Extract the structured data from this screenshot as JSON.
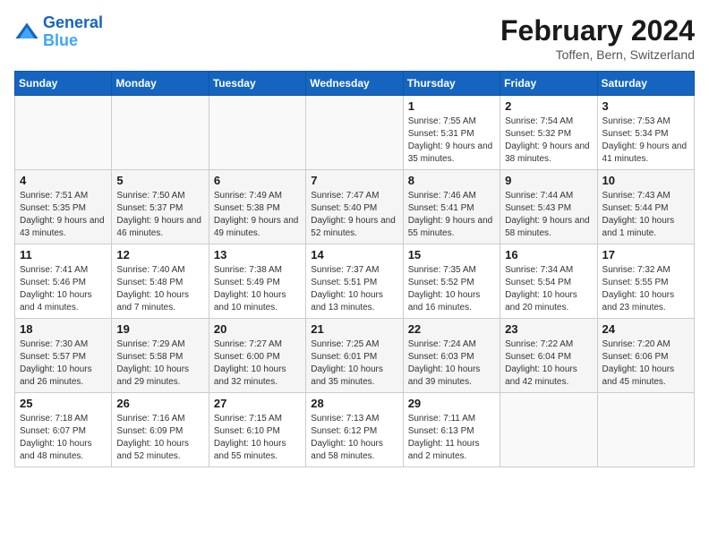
{
  "header": {
    "logo_line1": "General",
    "logo_line2": "Blue",
    "month_title": "February 2024",
    "subtitle": "Toffen, Bern, Switzerland"
  },
  "weekdays": [
    "Sunday",
    "Monday",
    "Tuesday",
    "Wednesday",
    "Thursday",
    "Friday",
    "Saturday"
  ],
  "weeks": [
    [
      {
        "day": "",
        "info": ""
      },
      {
        "day": "",
        "info": ""
      },
      {
        "day": "",
        "info": ""
      },
      {
        "day": "",
        "info": ""
      },
      {
        "day": "1",
        "info": "Sunrise: 7:55 AM\nSunset: 5:31 PM\nDaylight: 9 hours\nand 35 minutes."
      },
      {
        "day": "2",
        "info": "Sunrise: 7:54 AM\nSunset: 5:32 PM\nDaylight: 9 hours\nand 38 minutes."
      },
      {
        "day": "3",
        "info": "Sunrise: 7:53 AM\nSunset: 5:34 PM\nDaylight: 9 hours\nand 41 minutes."
      }
    ],
    [
      {
        "day": "4",
        "info": "Sunrise: 7:51 AM\nSunset: 5:35 PM\nDaylight: 9 hours\nand 43 minutes."
      },
      {
        "day": "5",
        "info": "Sunrise: 7:50 AM\nSunset: 5:37 PM\nDaylight: 9 hours\nand 46 minutes."
      },
      {
        "day": "6",
        "info": "Sunrise: 7:49 AM\nSunset: 5:38 PM\nDaylight: 9 hours\nand 49 minutes."
      },
      {
        "day": "7",
        "info": "Sunrise: 7:47 AM\nSunset: 5:40 PM\nDaylight: 9 hours\nand 52 minutes."
      },
      {
        "day": "8",
        "info": "Sunrise: 7:46 AM\nSunset: 5:41 PM\nDaylight: 9 hours\nand 55 minutes."
      },
      {
        "day": "9",
        "info": "Sunrise: 7:44 AM\nSunset: 5:43 PM\nDaylight: 9 hours\nand 58 minutes."
      },
      {
        "day": "10",
        "info": "Sunrise: 7:43 AM\nSunset: 5:44 PM\nDaylight: 10 hours\nand 1 minute."
      }
    ],
    [
      {
        "day": "11",
        "info": "Sunrise: 7:41 AM\nSunset: 5:46 PM\nDaylight: 10 hours\nand 4 minutes."
      },
      {
        "day": "12",
        "info": "Sunrise: 7:40 AM\nSunset: 5:48 PM\nDaylight: 10 hours\nand 7 minutes."
      },
      {
        "day": "13",
        "info": "Sunrise: 7:38 AM\nSunset: 5:49 PM\nDaylight: 10 hours\nand 10 minutes."
      },
      {
        "day": "14",
        "info": "Sunrise: 7:37 AM\nSunset: 5:51 PM\nDaylight: 10 hours\nand 13 minutes."
      },
      {
        "day": "15",
        "info": "Sunrise: 7:35 AM\nSunset: 5:52 PM\nDaylight: 10 hours\nand 16 minutes."
      },
      {
        "day": "16",
        "info": "Sunrise: 7:34 AM\nSunset: 5:54 PM\nDaylight: 10 hours\nand 20 minutes."
      },
      {
        "day": "17",
        "info": "Sunrise: 7:32 AM\nSunset: 5:55 PM\nDaylight: 10 hours\nand 23 minutes."
      }
    ],
    [
      {
        "day": "18",
        "info": "Sunrise: 7:30 AM\nSunset: 5:57 PM\nDaylight: 10 hours\nand 26 minutes."
      },
      {
        "day": "19",
        "info": "Sunrise: 7:29 AM\nSunset: 5:58 PM\nDaylight: 10 hours\nand 29 minutes."
      },
      {
        "day": "20",
        "info": "Sunrise: 7:27 AM\nSunset: 6:00 PM\nDaylight: 10 hours\nand 32 minutes."
      },
      {
        "day": "21",
        "info": "Sunrise: 7:25 AM\nSunset: 6:01 PM\nDaylight: 10 hours\nand 35 minutes."
      },
      {
        "day": "22",
        "info": "Sunrise: 7:24 AM\nSunset: 6:03 PM\nDaylight: 10 hours\nand 39 minutes."
      },
      {
        "day": "23",
        "info": "Sunrise: 7:22 AM\nSunset: 6:04 PM\nDaylight: 10 hours\nand 42 minutes."
      },
      {
        "day": "24",
        "info": "Sunrise: 7:20 AM\nSunset: 6:06 PM\nDaylight: 10 hours\nand 45 minutes."
      }
    ],
    [
      {
        "day": "25",
        "info": "Sunrise: 7:18 AM\nSunset: 6:07 PM\nDaylight: 10 hours\nand 48 minutes."
      },
      {
        "day": "26",
        "info": "Sunrise: 7:16 AM\nSunset: 6:09 PM\nDaylight: 10 hours\nand 52 minutes."
      },
      {
        "day": "27",
        "info": "Sunrise: 7:15 AM\nSunset: 6:10 PM\nDaylight: 10 hours\nand 55 minutes."
      },
      {
        "day": "28",
        "info": "Sunrise: 7:13 AM\nSunset: 6:12 PM\nDaylight: 10 hours\nand 58 minutes."
      },
      {
        "day": "29",
        "info": "Sunrise: 7:11 AM\nSunset: 6:13 PM\nDaylight: 11 hours\nand 2 minutes."
      },
      {
        "day": "",
        "info": ""
      },
      {
        "day": "",
        "info": ""
      }
    ]
  ]
}
